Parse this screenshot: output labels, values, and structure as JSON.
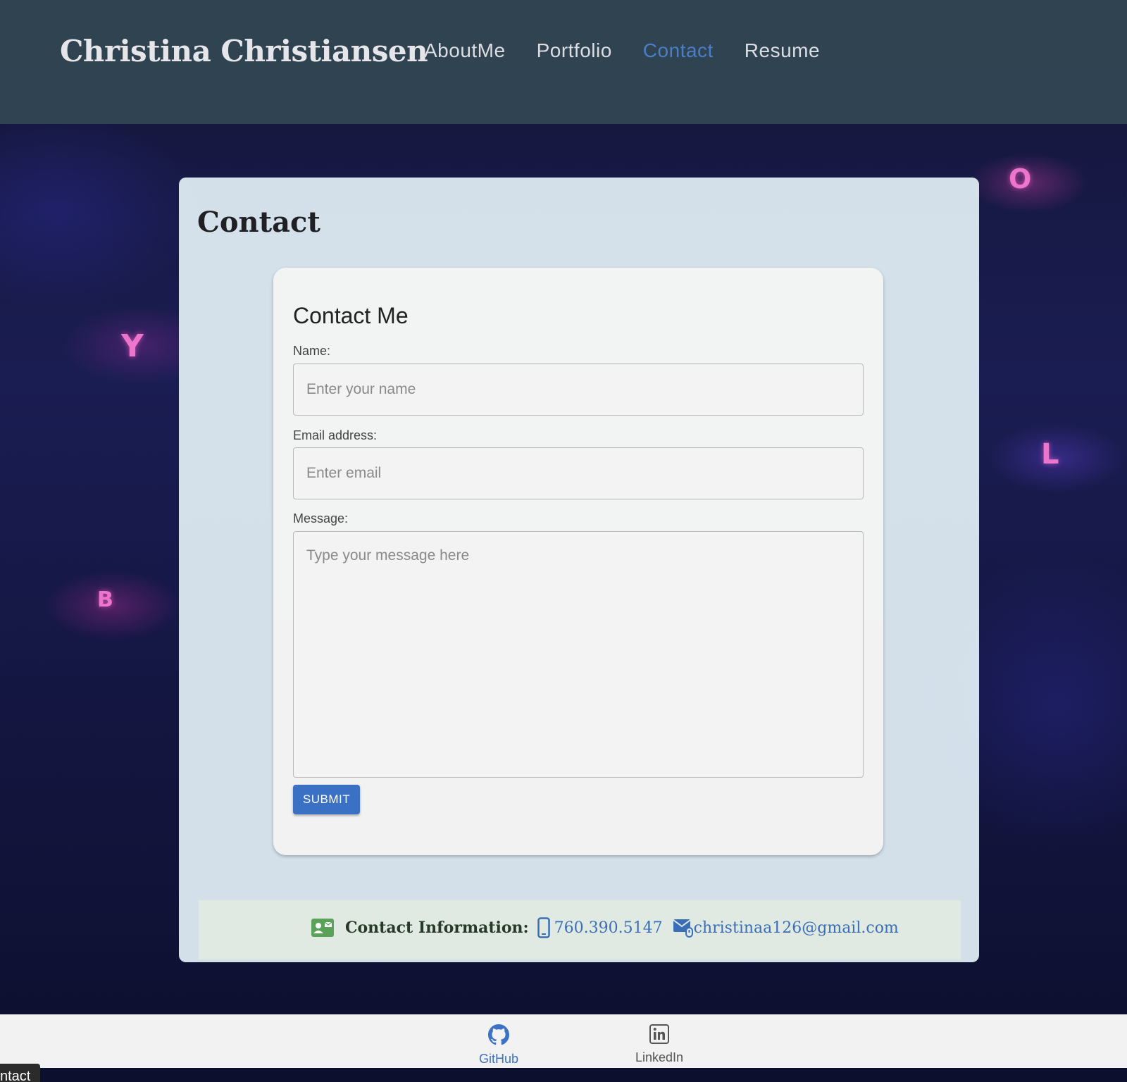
{
  "header": {
    "brand": "Christina Christiansen",
    "nav": [
      {
        "label": "AboutMe",
        "active": false
      },
      {
        "label": "Portfolio",
        "active": false
      },
      {
        "label": "Contact",
        "active": true
      },
      {
        "label": "Resume",
        "active": false
      }
    ]
  },
  "main": {
    "title": "Contact",
    "form": {
      "title": "Contact Me",
      "name_label": "Name:",
      "name_placeholder": "Enter your name",
      "email_label": "Email address:",
      "email_placeholder": "Enter email",
      "message_label": "Message:",
      "message_placeholder": "Type your message here",
      "submit_label": "SUBMIT"
    },
    "contact_info": {
      "label": "Contact Information:",
      "phone": "760.390.5147",
      "email": "christinaa126@gmail.com"
    }
  },
  "footer": {
    "github_label": "GitHub",
    "linkedin_label": "LinkedIn"
  },
  "tooltip": "ntact",
  "colors": {
    "accent": "#3a71c4",
    "nav_active": "#4a7ec7",
    "header_bg": "#324854",
    "panel_bg": "#dce8f0",
    "info_bar_bg": "#e1eae2",
    "contact_card_icon": "#5aa25a"
  },
  "icons": [
    "contact-card-icon",
    "phone-icon",
    "mail-icon",
    "github-icon",
    "linkedin-icon"
  ]
}
